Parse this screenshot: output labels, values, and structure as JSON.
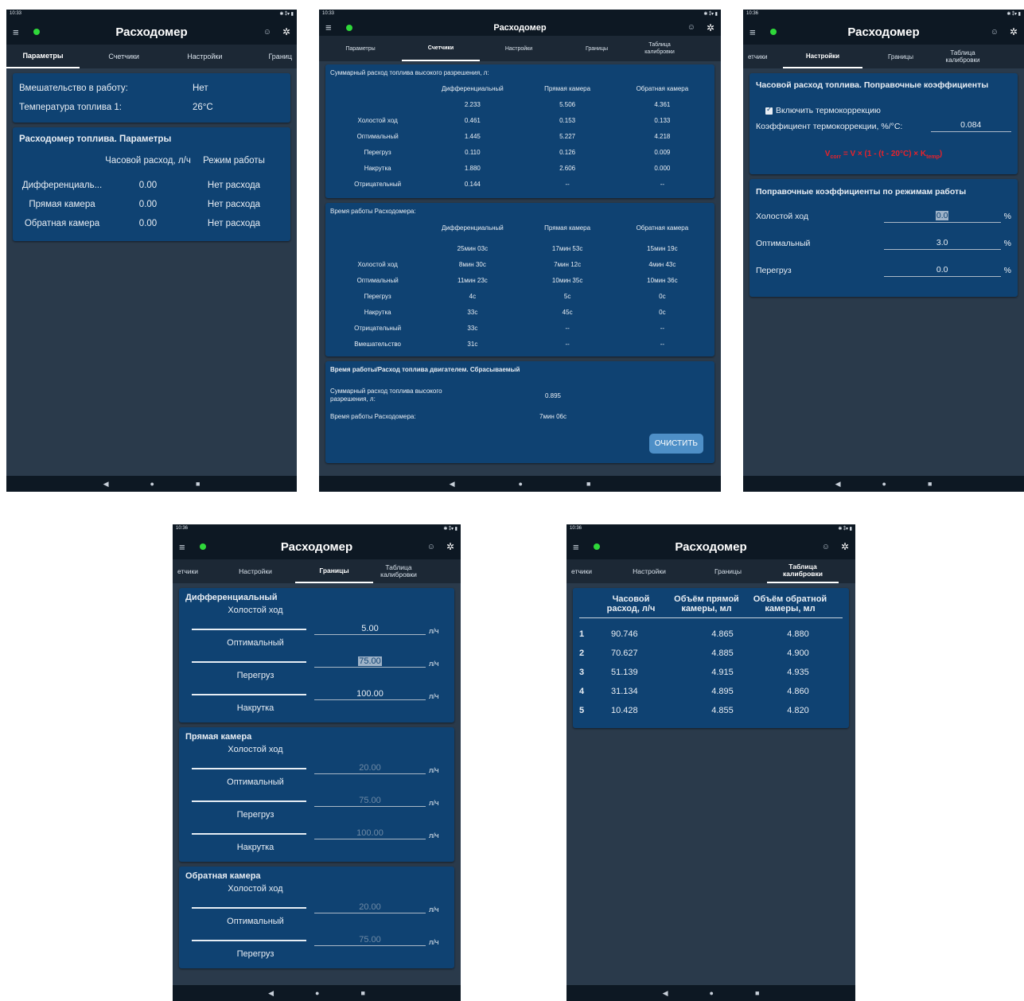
{
  "app": {
    "title": "Расходомер",
    "status_time_1": "10:33",
    "status_time_2": "10:33",
    "status_time_3": "10:36",
    "status_time_4": "10:36",
    "status_time_5": "10:36",
    "status_icons": "✱ ⁑▾ ▮",
    "status_dot_color": "#2fd83a"
  },
  "screen1": {
    "tabs": [
      "Параметры",
      "Счетчики",
      "Настройки",
      "Границ"
    ],
    "info": [
      {
        "label": "Вмешательство в работу:",
        "value": "Нет"
      },
      {
        "label": "Температура топлива 1:",
        "value": "26°C"
      }
    ],
    "params_title": "Расходомер топлива. Параметры",
    "col_hourly": "Часовой расход, л/ч",
    "col_mode": "Режим работы",
    "rows": [
      {
        "name": "Дифференциаль...",
        "rate": "0.00",
        "mode": "Нет расхода"
      },
      {
        "name": "Прямая камера",
        "rate": "0.00",
        "mode": "Нет расхода"
      },
      {
        "name": "Обратная камера",
        "rate": "0.00",
        "mode": "Нет расхода"
      }
    ]
  },
  "screen2": {
    "tabs": [
      "Параметры",
      "Счетчики",
      "Настройки",
      "Границы",
      "Таблица калибровки"
    ],
    "sum_title": "Суммарный расход топлива высокого разрешения, л:",
    "cols": [
      "Дифференциальный",
      "Прямая камера",
      "Обратная камера"
    ],
    "sum_rows": [
      {
        "name": "",
        "v": [
          "2.233",
          "5.506",
          "4.361"
        ]
      },
      {
        "name": "Холостой ход",
        "v": [
          "0.461",
          "0.153",
          "0.133"
        ]
      },
      {
        "name": "Оптимальный",
        "v": [
          "1.445",
          "5.227",
          "4.218"
        ]
      },
      {
        "name": "Перегруз",
        "v": [
          "0.110",
          "0.126",
          "0.009"
        ]
      },
      {
        "name": "Накрутка",
        "v": [
          "1.880",
          "2.606",
          "0.000"
        ]
      },
      {
        "name": "Отрицательный",
        "v": [
          "0.144",
          "--",
          "--"
        ]
      }
    ],
    "time_title": "Время работы Расходомера:",
    "time_rows": [
      {
        "name": "",
        "v": [
          "25мин 03с",
          "17мин 53с",
          "15мин 19с"
        ]
      },
      {
        "name": "Холостой ход",
        "v": [
          "8мин 30с",
          "7мин 12с",
          "4мин 43с"
        ]
      },
      {
        "name": "Оптимальный",
        "v": [
          "11мин 23с",
          "10мин 35с",
          "10мин 36с"
        ]
      },
      {
        "name": "Перегруз",
        "v": [
          "4с",
          "5с",
          "0с"
        ]
      },
      {
        "name": "Накрутка",
        "v": [
          "33с",
          "45с",
          "0с"
        ]
      },
      {
        "name": "Отрицательный",
        "v": [
          "33с",
          "--",
          "--"
        ]
      },
      {
        "name": "Вмешательство",
        "v": [
          "31с",
          "--",
          "--"
        ]
      }
    ],
    "reset_title": "Время работы/Расход топлива двигателем. Сбрасываемый",
    "reset_sum_label": "Суммарный расход топлива высокого разрешения, л:",
    "reset_sum_value": "0.895",
    "reset_time_label": "Время работы Расходомера:",
    "reset_time_value": "7мин 06с",
    "clear_button": "ОЧИСТИТЬ"
  },
  "screen3": {
    "tabs": [
      "етчики",
      "Настройки",
      "Границы",
      "Таблица калибровки"
    ],
    "title": "Часовой расход топлива. Поправочные коэффициенты",
    "checkbox_label": "Включить термокоррекцию",
    "checkbox_checked": true,
    "coef_label": "Коэффициент термокоррекции, %/°С:",
    "coef_value": "0.084",
    "formula_main": "V",
    "formula_sub": "corr",
    "formula_mid": " = V × (1 - (t - 20°C) × K",
    "formula_sub2": "temp",
    "formula_end": ")",
    "formula_color": "#e8222a",
    "modes_title": "Поправочные коэффициенты по режимам работы",
    "modes": [
      {
        "name": "Холостой ход",
        "value": "0.0",
        "unit": "%"
      },
      {
        "name": "Оптимальный",
        "value": "3.0",
        "unit": "%"
      },
      {
        "name": "Перегруз",
        "value": "0.0",
        "unit": "%"
      }
    ]
  },
  "screen4": {
    "tabs": [
      "етчики",
      "Настройки",
      "Границы",
      "Таблица калибровки"
    ],
    "unit": "л/ч",
    "sections": [
      {
        "title": "Дифференциальный",
        "idle": "Холостой ход",
        "opt": "Оптимальный",
        "over": "Перегруз",
        "wind": "Накрутка",
        "v1": "5.00",
        "v2": "75.00",
        "v3": "100.00"
      },
      {
        "title": "Прямая камера",
        "idle": "Холостой ход",
        "opt": "Оптимальный",
        "over": "Перегруз",
        "wind": "Накрутка",
        "v1": "20.00",
        "v2": "75.00",
        "v3": "100.00"
      },
      {
        "title": "Обратная камера",
        "idle": "Холостой ход",
        "opt": "Оптимальный",
        "over": "Перегруз",
        "v1": "20.00",
        "v2": "75.00"
      }
    ]
  },
  "screen5": {
    "tabs": [
      "етчики",
      "Настройки",
      "Границы",
      "Таблица калибровки"
    ],
    "headers": [
      "Часовой расход, л/ч",
      "Объём прямой камеры, мл",
      "Объём обратной камеры, мл"
    ],
    "rows": [
      {
        "n": "1",
        "rate": "90.746",
        "direct": "4.865",
        "reverse": "4.880"
      },
      {
        "n": "2",
        "rate": "70.627",
        "direct": "4.885",
        "reverse": "4.900"
      },
      {
        "n": "3",
        "rate": "51.139",
        "direct": "4.915",
        "reverse": "4.935"
      },
      {
        "n": "4",
        "rate": "31.134",
        "direct": "4.895",
        "reverse": "4.860"
      },
      {
        "n": "5",
        "rate": "10.428",
        "direct": "4.855",
        "reverse": "4.820"
      }
    ]
  },
  "nav": {
    "back": "◀",
    "home": "●",
    "recent": "■"
  }
}
